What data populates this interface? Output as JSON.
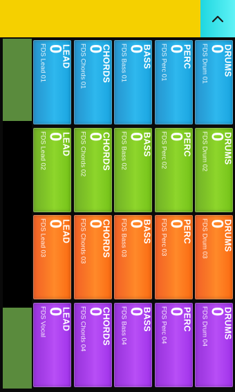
{
  "header": {
    "collapse_icon": "chevron-up-icon"
  },
  "colors": {
    "header_yellow": "#f5d000",
    "collapse_cyan": "#3fe6ec",
    "side_green": "#5a8b3d",
    "blue": "#1ea6e4",
    "green": "#7cc81c",
    "orange": "#fb6a12",
    "purple": "#a638ee"
  },
  "rows": [
    {
      "color": "blue",
      "pads": [
        {
          "category": "LEAD",
          "value": "0",
          "name": "FDS Lead 01"
        },
        {
          "category": "CHORDS",
          "value": "0",
          "name": "FDS Chords 01"
        },
        {
          "category": "BASS",
          "value": "0",
          "name": "FDS Bass 01"
        },
        {
          "category": "PERC",
          "value": "0",
          "name": "FDS Perc 01"
        },
        {
          "category": "DRUMS",
          "value": "0",
          "name": "FDS Drum 01"
        }
      ]
    },
    {
      "color": "green",
      "pads": [
        {
          "category": "LEAD",
          "value": "0",
          "name": "FDS Lead 02"
        },
        {
          "category": "CHORDS",
          "value": "0",
          "name": "FDS Chords 02"
        },
        {
          "category": "BASS",
          "value": "0",
          "name": "FDS Bass 02"
        },
        {
          "category": "PERC",
          "value": "0",
          "name": "FDS Perc 02"
        },
        {
          "category": "DRUMS",
          "value": "0",
          "name": "FDS Drum 02"
        }
      ]
    },
    {
      "color": "orange",
      "pads": [
        {
          "category": "LEAD",
          "value": "0",
          "name": "FDS Lead 03"
        },
        {
          "category": "CHORDS",
          "value": "0",
          "name": "FDS Chords 03"
        },
        {
          "category": "BASS",
          "value": "0",
          "name": "FDS Bass 03"
        },
        {
          "category": "PERC",
          "value": "0",
          "name": "FDS Perc 03"
        },
        {
          "category": "DRUMS",
          "value": "0",
          "name": "FDS Drum 03"
        }
      ]
    },
    {
      "color": "purple",
      "pads": [
        {
          "category": "LEAD",
          "value": "0",
          "name": "FDS Vocal"
        },
        {
          "category": "CHORDS",
          "value": "0",
          "name": "FDS Chords 04"
        },
        {
          "category": "BASS",
          "value": "0",
          "name": "FDS Bass 04"
        },
        {
          "category": "PERC",
          "value": "0",
          "name": "FDS Perc 04"
        },
        {
          "category": "DRUMS",
          "value": "0",
          "name": "FDS Drum 04"
        }
      ]
    }
  ]
}
